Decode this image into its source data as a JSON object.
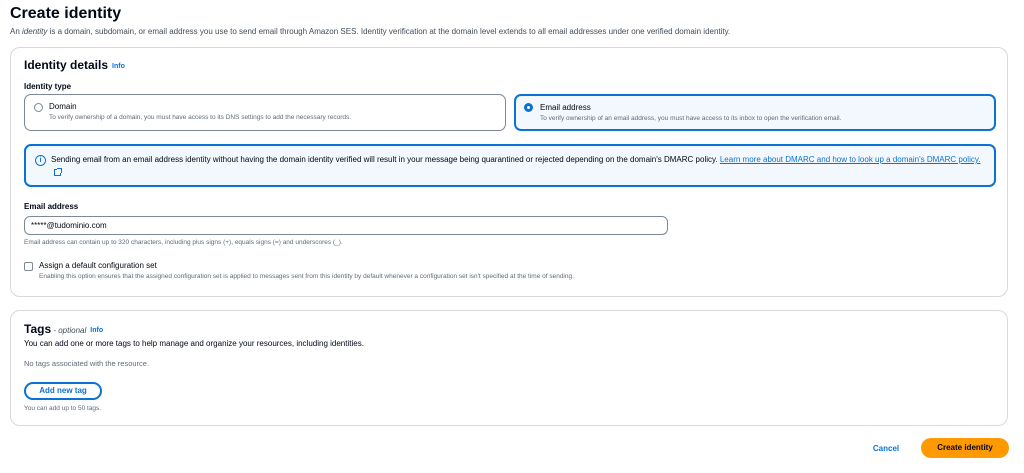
{
  "page": {
    "title": "Create identity",
    "desc_prefix": "An ",
    "desc_em": "identity",
    "desc_suffix": " is a domain, subdomain, or email address you use to send email through Amazon SES. Identity verification at the domain level extends to all email addresses under one verified domain identity."
  },
  "identity_details": {
    "heading": "Identity details",
    "info": "Info",
    "type_label": "Identity type",
    "options": [
      {
        "title": "Domain",
        "desc": "To verify ownership of a domain, you must have access to its DNS settings to add the necessary records.",
        "selected": false
      },
      {
        "title": "Email address",
        "desc": "To verify ownership of an email address, you must have access to its inbox to open the verification email.",
        "selected": true
      }
    ],
    "alert": {
      "icon": "info-icon",
      "text": "Sending email from an email address identity without having the domain identity verified will result in your message being quarantined or rejected depending on the domain's DMARC policy. ",
      "link": "Learn more about DMARC and how to look up a domain's DMARC policy."
    },
    "email_label": "Email address",
    "email_value": "*****@tudominio.com",
    "email_hint": "Email address can contain up to 320 characters, including plus signs (+), equals signs (=) and underscores (_).",
    "config_label": "Assign a default configuration set",
    "config_hint": "Enabling this option ensures that the assigned configuration set is applied to messages sent from this identity by default whenever a configuration set isn't specified at the time of sending.",
    "config_checked": false
  },
  "tags": {
    "heading": "Tags",
    "optional": " - optional",
    "info": "Info",
    "desc": "You can add one or more tags to help manage and organize your resources, including identities.",
    "empty": "No tags associated with the resource.",
    "add_button": "Add new tag",
    "limit": "You can add up to 50 tags."
  },
  "footer": {
    "cancel": "Cancel",
    "submit": "Create identity"
  },
  "colors": {
    "primary": "#0972d3",
    "cta": "#ff9900",
    "info_bg": "#f2f8fd"
  }
}
